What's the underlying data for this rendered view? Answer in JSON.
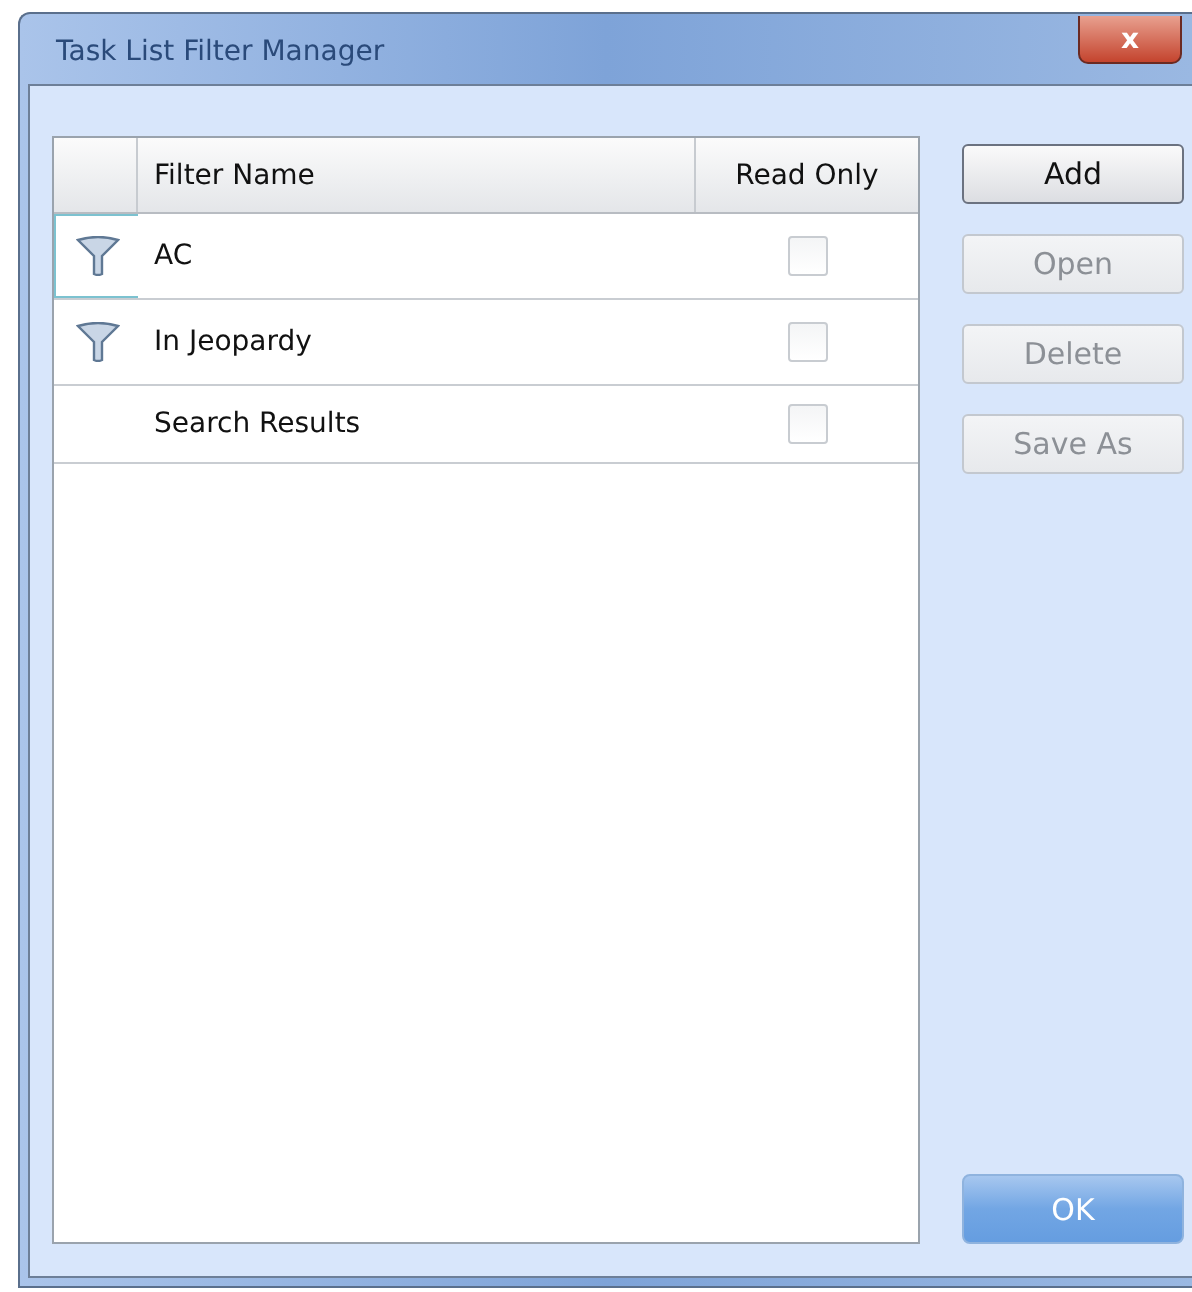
{
  "window": {
    "title": "Task List Filter Manager",
    "close": "x"
  },
  "table": {
    "columns": [
      "Filter Name",
      "Read Only"
    ],
    "rows": [
      {
        "icon": true,
        "selected": true,
        "name": "AC",
        "read_only": false
      },
      {
        "icon": true,
        "selected": false,
        "name": "In Jeopardy",
        "read_only": false
      },
      {
        "icon": false,
        "selected": false,
        "name": "Search Results",
        "read_only": false
      }
    ]
  },
  "buttons": [
    {
      "label": "Add",
      "disabled": false
    },
    {
      "label": "Open",
      "disabled": true
    },
    {
      "label": "Delete",
      "disabled": true
    },
    {
      "label": "Save As",
      "disabled": true
    }
  ],
  "ok": {
    "label": "OK"
  }
}
